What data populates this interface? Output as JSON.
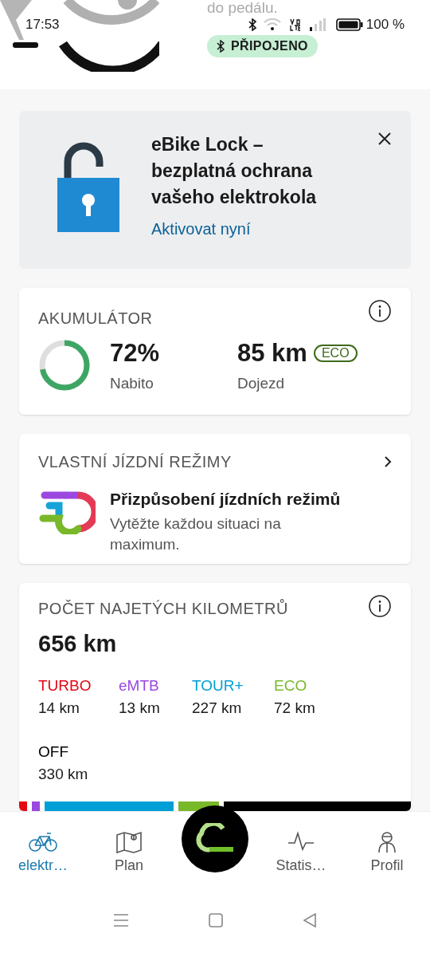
{
  "status_bar": {
    "time": "17:53",
    "battery": "100 %"
  },
  "header": {
    "hint": "do pedálu.",
    "connection": "PŘIPOJENO",
    "connected": true
  },
  "promo": {
    "title": "eBike Lock – bezplatná ochrana vašeho elektrokola",
    "link": "Aktivovat nyní"
  },
  "battery_card": {
    "title": "AKUMULÁTOR",
    "level": 0.72,
    "percent": "72%",
    "percent_label": "Nabito",
    "range": "85 km",
    "mode": "ECO",
    "range_label": "Dojezd"
  },
  "modes_card": {
    "title": "VLASTNÍ JÍZDNÍ REŽIMY",
    "heading": "Přizpůsobení jízdních režimů",
    "text": "Vytěžte každou situaci na maximum."
  },
  "km_card": {
    "title": "POČET NAJETÝCH KILOMETRŮ",
    "total": "656 km",
    "modes": [
      {
        "name": "TURBO",
        "distance": "14 km",
        "color": "#e30613"
      },
      {
        "name": "eMTB",
        "distance": "13 km",
        "color": "#9b48e0"
      },
      {
        "name": "TOUR+",
        "distance": "227 km",
        "color": "#00a0d6"
      },
      {
        "name": "ECO",
        "distance": "72 km",
        "color": "#78b82a"
      },
      {
        "name": "OFF",
        "distance": "330 km",
        "color": "#000000"
      }
    ]
  },
  "nav": [
    {
      "label": "elektr…",
      "kind": "bike",
      "selected": true
    },
    {
      "label": "Plan",
      "kind": "map",
      "selected": false
    },
    {
      "kind": "center",
      "selected": false
    },
    {
      "label": "Statis…",
      "kind": "stats",
      "selected": false
    },
    {
      "label": "Profil",
      "kind": "profile",
      "selected": false
    }
  ]
}
